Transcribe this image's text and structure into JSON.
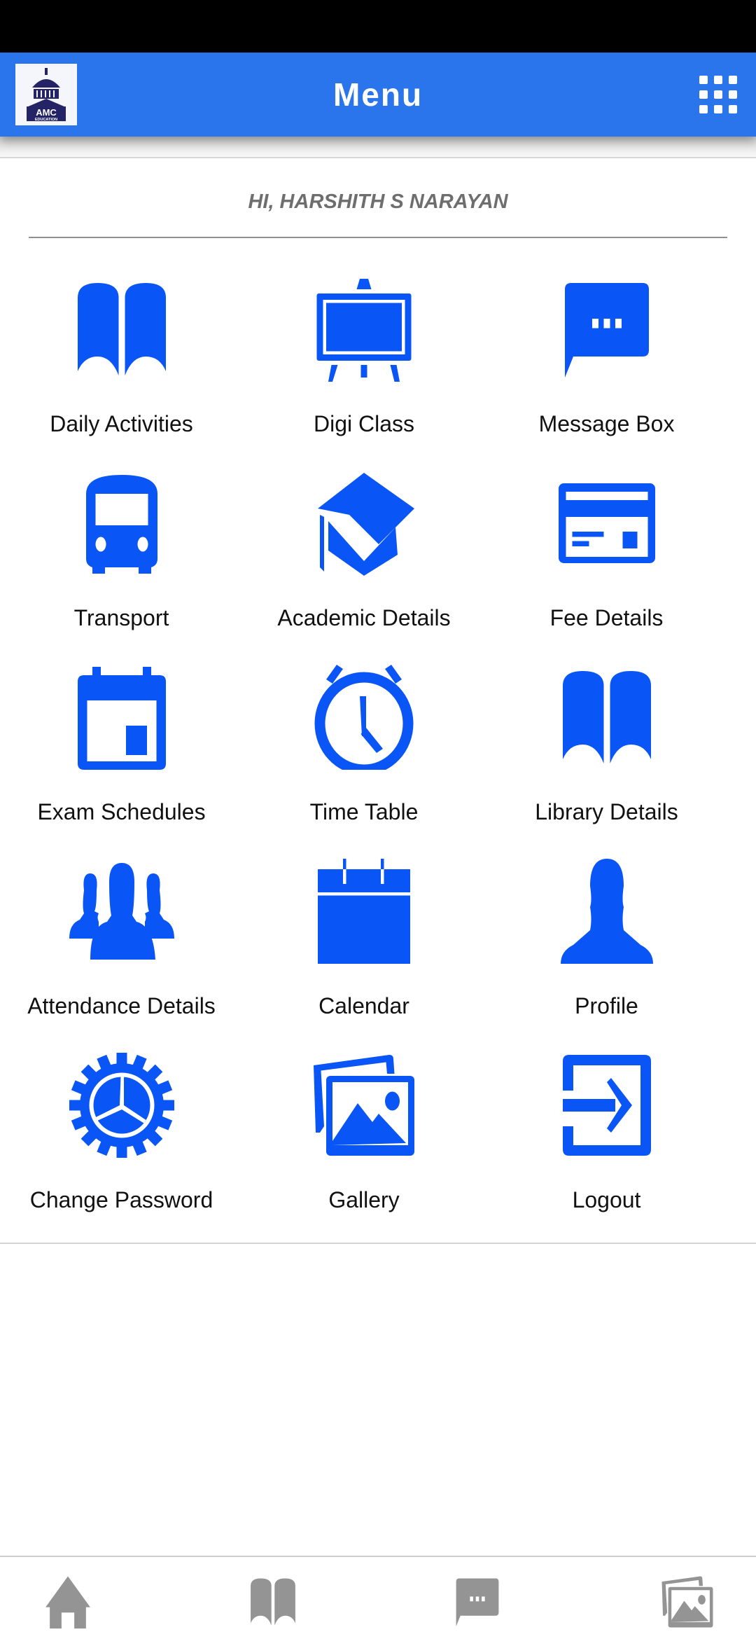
{
  "app_bar": {
    "logo": {
      "icon": "amc-education-logo",
      "text": "AMC",
      "subtext": "EDUCATION"
    },
    "title": "Menu",
    "grid_button_icon": "apps-grid-icon"
  },
  "greeting": "HI, HARSHITH S NARAYAN",
  "colors": {
    "app_bar": "#2a74ec",
    "icon_blue": "#0a55f5",
    "nav_icon_gray": "#949494",
    "greeting_gray": "#6e6e6e"
  },
  "menu": {
    "items": [
      {
        "label": "Daily Activities",
        "icon": "book-open-icon"
      },
      {
        "label": "Digi Class",
        "icon": "easel-board-icon"
      },
      {
        "label": "Message Box",
        "icon": "chat-bubble-icon"
      },
      {
        "label": "Transport",
        "icon": "bus-icon"
      },
      {
        "label": "Academic Details",
        "icon": "graduation-cap-icon"
      },
      {
        "label": "Fee Details",
        "icon": "credit-card-icon"
      },
      {
        "label": "Exam Schedules",
        "icon": "calendar-event-icon"
      },
      {
        "label": "Time Table",
        "icon": "alarm-clock-icon"
      },
      {
        "label": "Library Details",
        "icon": "book-open-icon"
      },
      {
        "label": "Attendance Details",
        "icon": "group-icon"
      },
      {
        "label": "Calendar",
        "icon": "calendar-icon"
      },
      {
        "label": "Profile",
        "icon": "person-icon"
      },
      {
        "label": "Change Password",
        "icon": "gear-icon"
      },
      {
        "label": "Gallery",
        "icon": "photos-icon"
      },
      {
        "label": "Logout",
        "icon": "logout-icon"
      }
    ]
  },
  "bottom_nav": {
    "items": [
      {
        "name": "home",
        "icon": "home-icon"
      },
      {
        "name": "daily-activities",
        "icon": "book-open-icon"
      },
      {
        "name": "messages",
        "icon": "chat-bubble-icon"
      },
      {
        "name": "gallery",
        "icon": "photos-icon"
      }
    ]
  }
}
